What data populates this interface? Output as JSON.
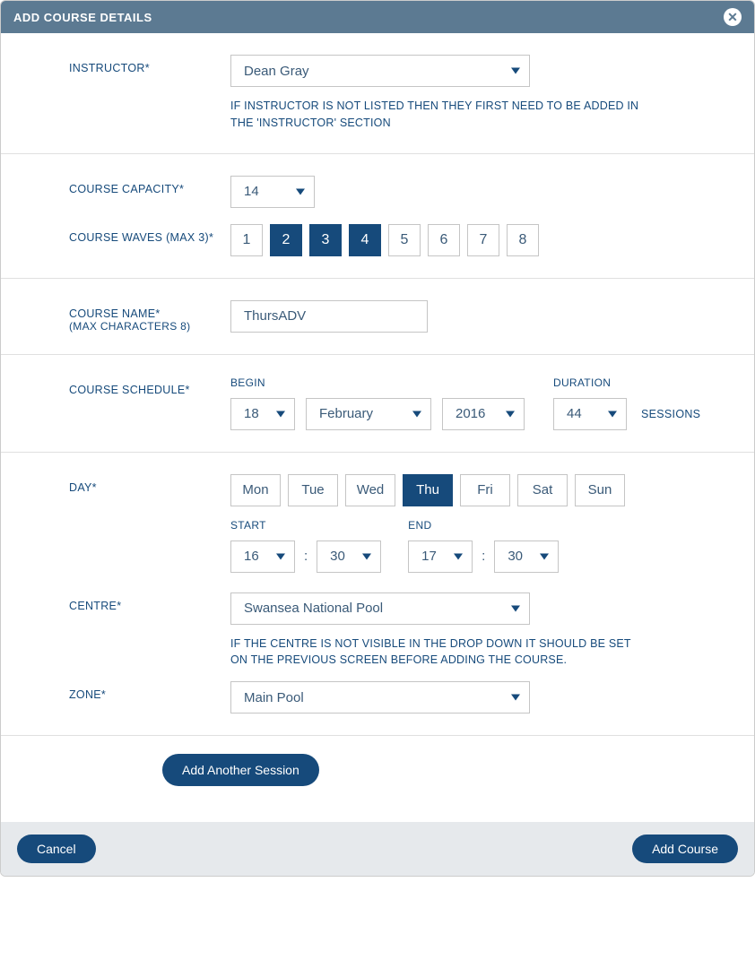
{
  "modal": {
    "title": "ADD COURSE DETAILS"
  },
  "instructor": {
    "label": "INSTRUCTOR*",
    "value": "Dean Gray",
    "helper": "IF INSTRUCTOR IS NOT LISTED THEN THEY FIRST NEED TO BE ADDED IN THE 'INSTRUCTOR' SECTION"
  },
  "capacity": {
    "label": "COURSE CAPACITY*",
    "value": "14"
  },
  "waves": {
    "label": "COURSE WAVES (MAX 3)*",
    "options": [
      "1",
      "2",
      "3",
      "4",
      "5",
      "6",
      "7",
      "8"
    ],
    "selected": [
      "2",
      "3",
      "4"
    ]
  },
  "course_name": {
    "label": "COURSE NAME*",
    "sublabel": "(MAX CHARACTERS 8)",
    "value": "ThursADV"
  },
  "schedule": {
    "label": "COURSE SCHEDULE*",
    "begin_label": "BEGIN",
    "duration_label": "DURATION",
    "sessions_label": "SESSIONS",
    "day": "18",
    "month": "February",
    "year": "2016",
    "duration": "44"
  },
  "day": {
    "label": "DAY*",
    "options": [
      "Mon",
      "Tue",
      "Wed",
      "Thu",
      "Fri",
      "Sat",
      "Sun"
    ],
    "selected": "Thu",
    "start_label": "START",
    "end_label": "END",
    "start_h": "16",
    "start_m": "30",
    "end_h": "17",
    "end_m": "30"
  },
  "centre": {
    "label": "CENTRE*",
    "value": "Swansea National Pool",
    "helper": "IF THE CENTRE IS NOT VISIBLE IN THE DROP DOWN IT SHOULD BE SET ON THE PREVIOUS SCREEN BEFORE ADDING THE COURSE."
  },
  "zone": {
    "label": "ZONE*",
    "value": "Main Pool"
  },
  "buttons": {
    "add_session": "Add Another Session",
    "cancel": "Cancel",
    "add_course": "Add Course"
  }
}
